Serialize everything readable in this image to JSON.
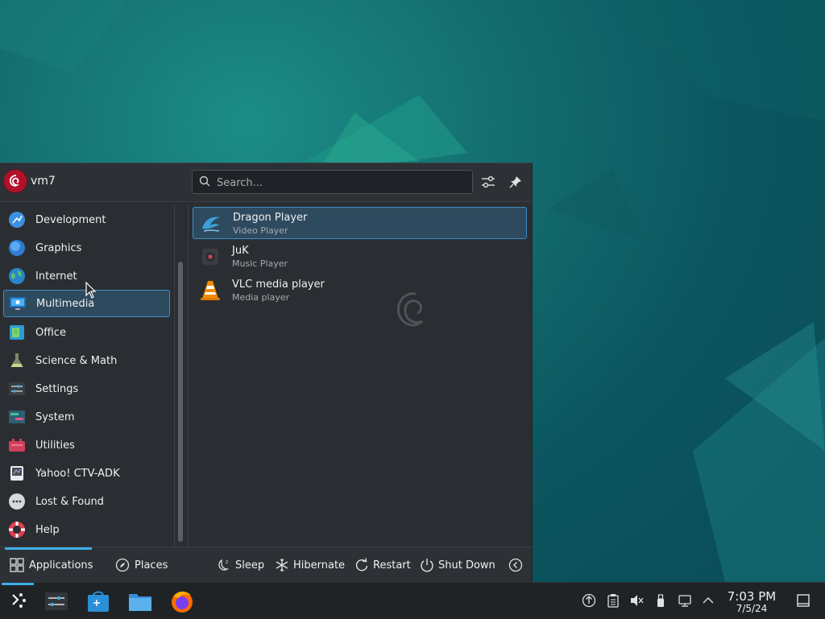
{
  "user": {
    "name": "vm7"
  },
  "search": {
    "placeholder": "Search..."
  },
  "categories": [
    {
      "label": "Development",
      "icon": "development-icon"
    },
    {
      "label": "Graphics",
      "icon": "graphics-icon"
    },
    {
      "label": "Internet",
      "icon": "internet-icon"
    },
    {
      "label": "Multimedia",
      "icon": "multimedia-icon",
      "selected": true
    },
    {
      "label": "Office",
      "icon": "office-icon"
    },
    {
      "label": "Science & Math",
      "icon": "science-icon"
    },
    {
      "label": "Settings",
      "icon": "settings-icon"
    },
    {
      "label": "System",
      "icon": "system-icon"
    },
    {
      "label": "Utilities",
      "icon": "utilities-icon"
    },
    {
      "label": "Yahoo! CTV-ADK",
      "icon": "yahoo-icon"
    },
    {
      "label": "Lost & Found",
      "icon": "lost-found-icon"
    },
    {
      "label": "Help",
      "icon": "help-icon"
    }
  ],
  "apps": [
    {
      "name": "Dragon Player",
      "desc": "Video Player",
      "icon": "dragon-player-icon",
      "selected": true
    },
    {
      "name": "JuK",
      "desc": "Music Player",
      "icon": "juk-icon"
    },
    {
      "name": "VLC media player",
      "desc": "Media player",
      "icon": "vlc-icon"
    }
  ],
  "footer": {
    "tabs": {
      "applications": "Applications",
      "places": "Places"
    },
    "power": {
      "sleep": "Sleep",
      "hibernate": "Hibernate",
      "restart": "Restart",
      "shutdown": "Shut Down"
    }
  },
  "taskbar": {
    "clock_time": "7:03 PM",
    "clock_date": "7/5/24",
    "apps": [
      "system-settings-icon",
      "discover-icon",
      "dolphin-icon",
      "firefox-icon"
    ]
  },
  "colors": {
    "accent": "#3daee9",
    "selection": "#2e4a5e",
    "panel": "#2a2e32",
    "taskbar": "#202326"
  }
}
